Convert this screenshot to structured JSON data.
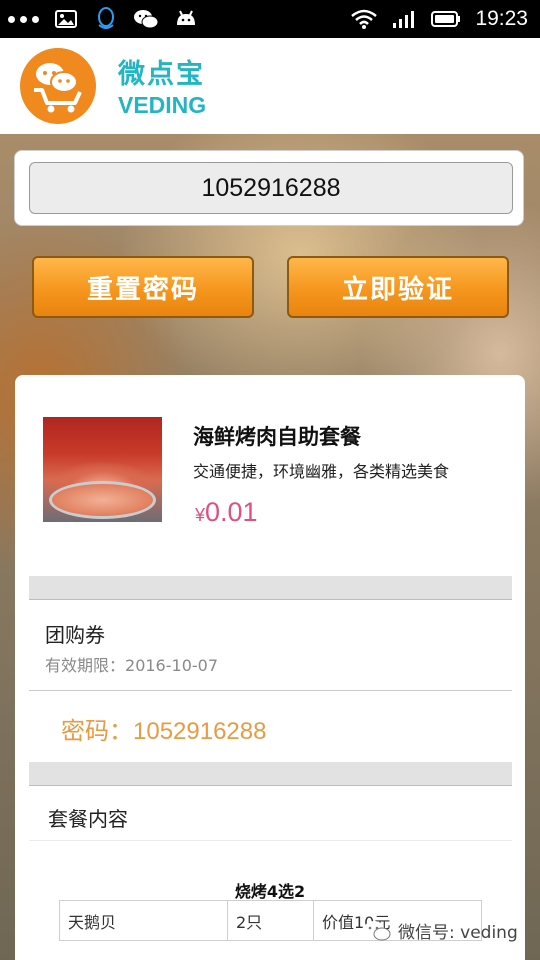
{
  "status_bar": {
    "time": "19:23",
    "left_icons": [
      "more-dots-icon",
      "image-icon",
      "qq-icon",
      "wechat-icon",
      "android-icon"
    ],
    "right_icons": [
      "wifi-icon",
      "signal-icon",
      "battery-icon"
    ]
  },
  "header": {
    "brand_cn": "微点宝",
    "brand_en": "VEDING",
    "logo_icon": "chat-cart-logo-icon",
    "logo_color": "#f0891e",
    "brand_color": "#22b5c4"
  },
  "code_input": {
    "value": "1052916288"
  },
  "actions": {
    "reset_label": "重置密码",
    "verify_label": "立即验证",
    "button_color": "#f5961e"
  },
  "deal": {
    "title": "海鲜烤肉自助套餐",
    "description": "交通便捷，环境幽雅，各类精选美食",
    "currency": "¥",
    "price": "0.01",
    "price_color": "#e0507f"
  },
  "voucher": {
    "type": "团购券",
    "validity_label": "有效期限：",
    "validity_date": "2016-10-07",
    "code_label": "密码：",
    "code_value": "1052916288",
    "code_color": "#ea9a43"
  },
  "package": {
    "section_title": "套餐内容",
    "table_caption": "烧烤4选2",
    "rows": [
      [
        "天鹅贝",
        "2只",
        "价值10元"
      ]
    ]
  },
  "watermark": {
    "icon": "wechat-icon",
    "text": "微信号: veding"
  }
}
